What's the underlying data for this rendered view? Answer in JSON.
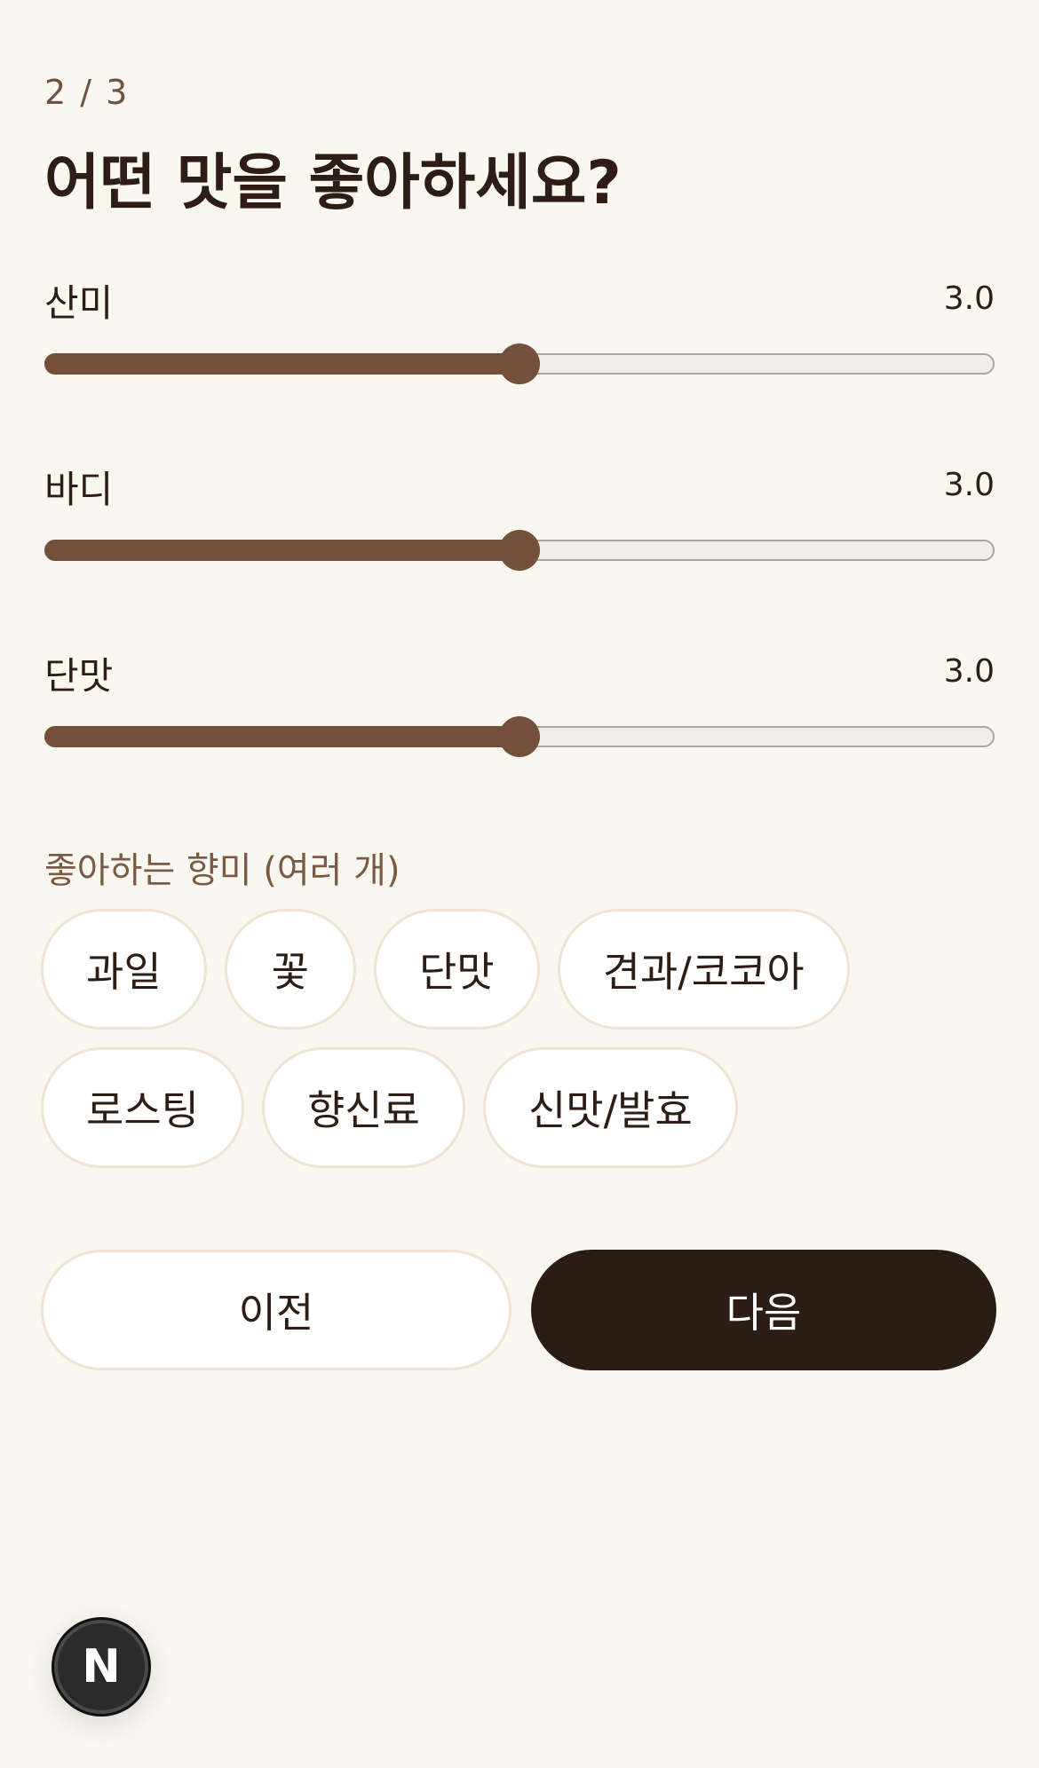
{
  "header": {
    "step": "2 / 3",
    "title": "어떤 맛을 좋아하세요?"
  },
  "sliders": [
    {
      "label": "산미",
      "value_text": "3.0",
      "value": 3.0,
      "min": 0,
      "max": 6
    },
    {
      "label": "바디",
      "value_text": "3.0",
      "value": 3.0,
      "min": 0,
      "max": 6
    },
    {
      "label": "단맛",
      "value_text": "3.0",
      "value": 3.0,
      "min": 0,
      "max": 6
    }
  ],
  "flavors": {
    "label": "좋아하는 향미 (여러 개)",
    "options": [
      "과일",
      "꽃",
      "단맛",
      "견과/코코아",
      "로스팅",
      "향신료",
      "신맛/발효"
    ]
  },
  "actions": {
    "prev_label": "이전",
    "next_label": "다음"
  },
  "badge": {
    "letter": "N"
  },
  "colors": {
    "accent": "#744f39",
    "dark": "#2c1d14",
    "background": "#faf6f0",
    "chip_border": "#efe3d3"
  }
}
